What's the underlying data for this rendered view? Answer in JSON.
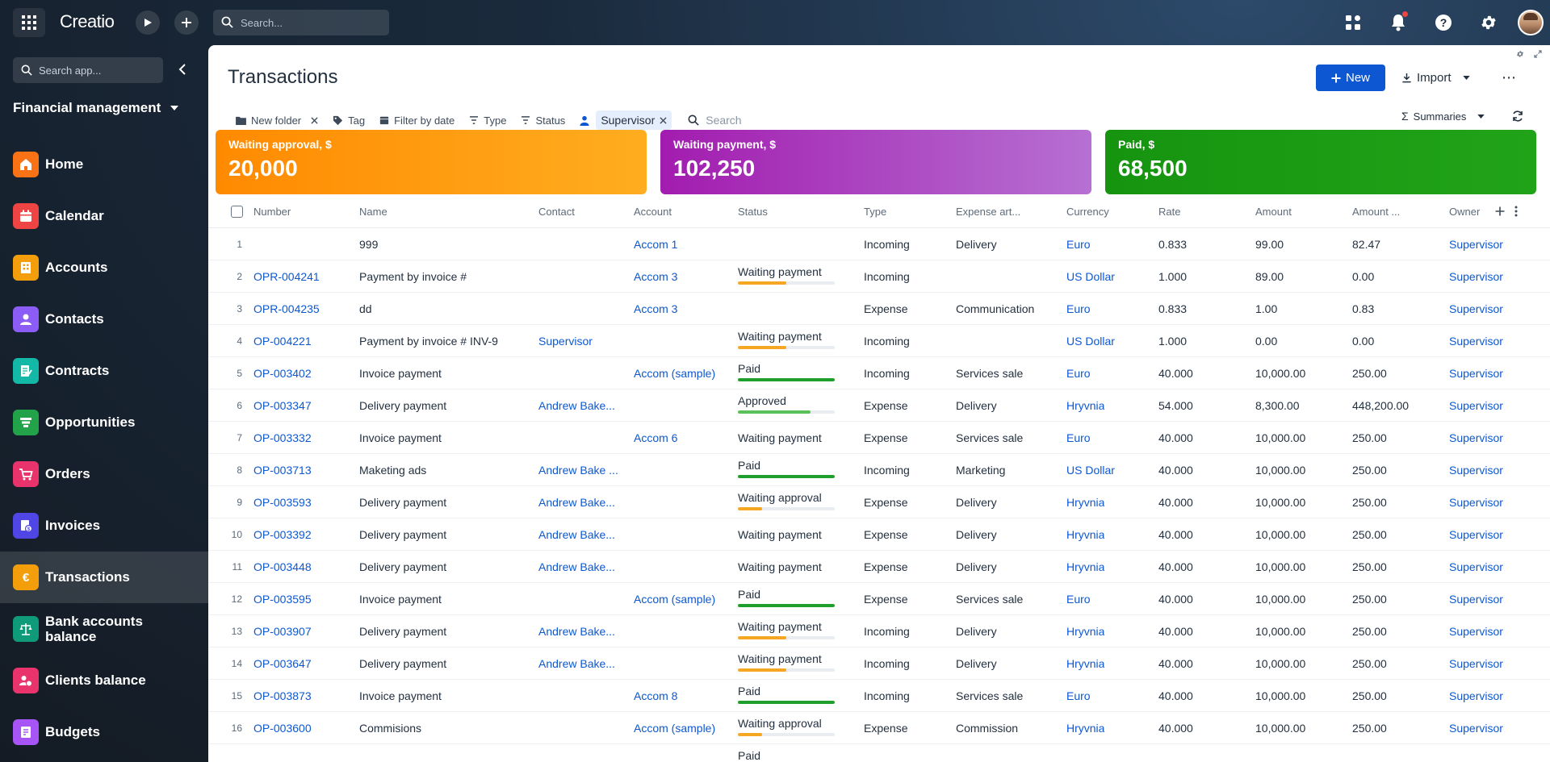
{
  "app": {
    "logo": "Creatio"
  },
  "topbar": {
    "search_placeholder": "Search..."
  },
  "sidebar": {
    "search_placeholder": "Search app...",
    "workspace": "Financial management",
    "items": [
      {
        "label": "Home",
        "color": "#f97316"
      },
      {
        "label": "Calendar",
        "color": "#ef4444"
      },
      {
        "label": "Accounts",
        "color": "#f59e0b"
      },
      {
        "label": "Contacts",
        "color": "#8b5cf6"
      },
      {
        "label": "Contracts",
        "color": "#14b8a6"
      },
      {
        "label": "Opportunities",
        "color": "#22a34a"
      },
      {
        "label": "Orders",
        "color": "#e8336d"
      },
      {
        "label": "Invoices",
        "color": "#4f46e5"
      },
      {
        "label": "Transactions",
        "color": "#f59e0b",
        "active": true
      },
      {
        "label": "Bank accounts balance",
        "color": "#0f9a7a"
      },
      {
        "label": "Clients balance",
        "color": "#e8336d"
      },
      {
        "label": "Budgets",
        "color": "#a855f7"
      }
    ]
  },
  "page": {
    "title": "Transactions",
    "new_label": "New",
    "import_label": "Import",
    "more_label": "⋯",
    "summaries_label": "Summaries"
  },
  "filters": {
    "folder": "New folder",
    "tag": "Tag",
    "date": "Filter by date",
    "type": "Type",
    "status": "Status",
    "owner_chip": "Supervisor",
    "search_placeholder": "Search"
  },
  "kpis": [
    {
      "label": "Waiting approval, $",
      "value": "20,000",
      "from": "#ff8a00",
      "to": "#ffad20"
    },
    {
      "label": "Waiting payment, $",
      "value": "102,250",
      "from": "#a21caf",
      "to": "#b670d2"
    },
    {
      "label": "Paid, $",
      "value": "68,500",
      "from": "#169410",
      "to": "#21a318"
    }
  ],
  "columns": [
    "Number",
    "Name",
    "Contact",
    "Account",
    "Status",
    "Type",
    "Expense art...",
    "Currency",
    "Rate",
    "Amount",
    "Amount ...",
    "Owner"
  ],
  "status_colors": {
    "Waiting payment": "#f5a623",
    "Waiting approval": "#f5a623",
    "Paid": "#1e9e2a",
    "Approved": "#59c05a"
  },
  "rows": [
    {
      "n": "1",
      "number": "",
      "name": "999",
      "contact": "",
      "account": "Accom 1",
      "status": "",
      "status_plain": false,
      "progress": 0,
      "type": "Incoming",
      "expense": "Delivery",
      "currency": "Euro",
      "rate": "0.833",
      "amount": "99.00",
      "amount2": "82.47",
      "owner": "Supervisor"
    },
    {
      "n": "2",
      "number": "OPR-004241",
      "name": "Payment by invoice #",
      "contact": "",
      "account": "Accom 3",
      "status": "Waiting payment",
      "status_plain": false,
      "progress": 0.5,
      "type": "Incoming",
      "expense": "",
      "currency": "US Dollar",
      "rate": "1.000",
      "amount": "89.00",
      "amount2": "0.00",
      "owner": "Supervisor"
    },
    {
      "n": "3",
      "number": "OPR-004235",
      "name": "dd",
      "contact": "",
      "account": "Accom 3",
      "status": "",
      "status_plain": false,
      "progress": 0,
      "type": "Expense",
      "expense": "Communication",
      "currency": "Euro",
      "rate": "0.833",
      "amount": "1.00",
      "amount2": "0.83",
      "owner": "Supervisor"
    },
    {
      "n": "4",
      "number": "OP-004221",
      "name": "Payment by invoice # INV-9",
      "contact": "Supervisor",
      "account": "",
      "status": "Waiting payment",
      "status_plain": false,
      "progress": 0.5,
      "type": "Incoming",
      "expense": "",
      "currency": "US Dollar",
      "rate": "1.000",
      "amount": "0.00",
      "amount2": "0.00",
      "owner": "Supervisor"
    },
    {
      "n": "5",
      "number": "OP-003402",
      "name": "Invoice payment",
      "contact": "",
      "account": "Accom (sample)",
      "status": "Paid",
      "status_plain": false,
      "progress": 1,
      "type": "Incoming",
      "expense": "Services sale",
      "currency": "Euro",
      "rate": "40.000",
      "amount": "10,000.00",
      "amount2": "250.00",
      "owner": "Supervisor"
    },
    {
      "n": "6",
      "number": "OP-003347",
      "name": "Delivery payment",
      "contact": "Andrew Bake...",
      "account": "",
      "status": "Approved",
      "status_plain": false,
      "progress": 0.75,
      "type": "Expense",
      "expense": "Delivery",
      "currency": "Hryvnia",
      "rate": "54.000",
      "amount": "8,300.00",
      "amount2": "448,200.00",
      "owner": "Supervisor"
    },
    {
      "n": "7",
      "number": "OP-003332",
      "name": "Invoice payment",
      "contact": "",
      "account": "Accom 6",
      "status": "Waiting payment",
      "status_plain": true,
      "progress": 0,
      "type": "Expense",
      "expense": "Services sale",
      "currency": "Euro",
      "rate": "40.000",
      "amount": "10,000.00",
      "amount2": "250.00",
      "owner": "Supervisor"
    },
    {
      "n": "8",
      "number": "OP-003713",
      "name": "Maketing ads",
      "contact": "Andrew Bake ...",
      "account": "",
      "status": "Paid",
      "status_plain": false,
      "progress": 1,
      "type": "Incoming",
      "expense": "Marketing",
      "currency": "US Dollar",
      "rate": "40.000",
      "amount": "10,000.00",
      "amount2": "250.00",
      "owner": "Supervisor"
    },
    {
      "n": "9",
      "number": "OP-003593",
      "name": "Delivery payment",
      "contact": "Andrew Bake...",
      "account": "",
      "status": "Waiting approval",
      "status_plain": false,
      "progress": 0.25,
      "type": "Expense",
      "expense": "Delivery",
      "currency": "Hryvnia",
      "rate": "40.000",
      "amount": "10,000.00",
      "amount2": "250.00",
      "owner": "Supervisor"
    },
    {
      "n": "10",
      "number": "OP-003392",
      "name": "Delivery payment",
      "contact": "Andrew Bake...",
      "account": "",
      "status": "Waiting payment",
      "status_plain": true,
      "progress": 0,
      "type": "Expense",
      "expense": "Delivery",
      "currency": "Hryvnia",
      "rate": "40.000",
      "amount": "10,000.00",
      "amount2": "250.00",
      "owner": "Supervisor"
    },
    {
      "n": "11",
      "number": "OP-003448",
      "name": "Delivery payment",
      "contact": "Andrew Bake...",
      "account": "",
      "status": "Waiting payment",
      "status_plain": true,
      "progress": 0,
      "type": "Expense",
      "expense": "Delivery",
      "currency": "Hryvnia",
      "rate": "40.000",
      "amount": "10,000.00",
      "amount2": "250.00",
      "owner": "Supervisor"
    },
    {
      "n": "12",
      "number": "OP-003595",
      "name": "Invoice payment",
      "contact": "",
      "account": "Accom (sample)",
      "status": "Paid",
      "status_plain": false,
      "progress": 1,
      "type": "Expense",
      "expense": "Services sale",
      "currency": "Euro",
      "rate": "40.000",
      "amount": "10,000.00",
      "amount2": "250.00",
      "owner": "Supervisor"
    },
    {
      "n": "13",
      "number": "OP-003907",
      "name": "Delivery payment",
      "contact": "Andrew Bake...",
      "account": "",
      "status": "Waiting payment",
      "status_plain": false,
      "progress": 0.5,
      "type": "Incoming",
      "expense": "Delivery",
      "currency": "Hryvnia",
      "rate": "40.000",
      "amount": "10,000.00",
      "amount2": "250.00",
      "owner": "Supervisor"
    },
    {
      "n": "14",
      "number": "OP-003647",
      "name": "Delivery payment",
      "contact": "Andrew Bake...",
      "account": "",
      "status": "Waiting payment",
      "status_plain": false,
      "progress": 0.5,
      "type": "Incoming",
      "expense": "Delivery",
      "currency": "Hryvnia",
      "rate": "40.000",
      "amount": "10,000.00",
      "amount2": "250.00",
      "owner": "Supervisor"
    },
    {
      "n": "15",
      "number": "OP-003873",
      "name": "Invoice payment",
      "contact": "",
      "account": "Accom 8",
      "status": "Paid",
      "status_plain": false,
      "progress": 1,
      "type": "Incoming",
      "expense": "Services sale",
      "currency": "Euro",
      "rate": "40.000",
      "amount": "10,000.00",
      "amount2": "250.00",
      "owner": "Supervisor"
    },
    {
      "n": "16",
      "number": "OP-003600",
      "name": "Commisions",
      "contact": "",
      "account": "Accom (sample)",
      "status": "Waiting approval",
      "status_plain": false,
      "progress": 0.25,
      "type": "Expense",
      "expense": "Commission",
      "currency": "Hryvnia",
      "rate": "40.000",
      "amount": "10,000.00",
      "amount2": "250.00",
      "owner": "Supervisor"
    },
    {
      "n": "",
      "number": "",
      "name": "",
      "contact": "",
      "account": "",
      "status": "Paid",
      "status_plain": false,
      "progress": 1,
      "type": "",
      "expense": "",
      "currency": "",
      "rate": "",
      "amount": "",
      "amount2": "",
      "owner": ""
    }
  ]
}
